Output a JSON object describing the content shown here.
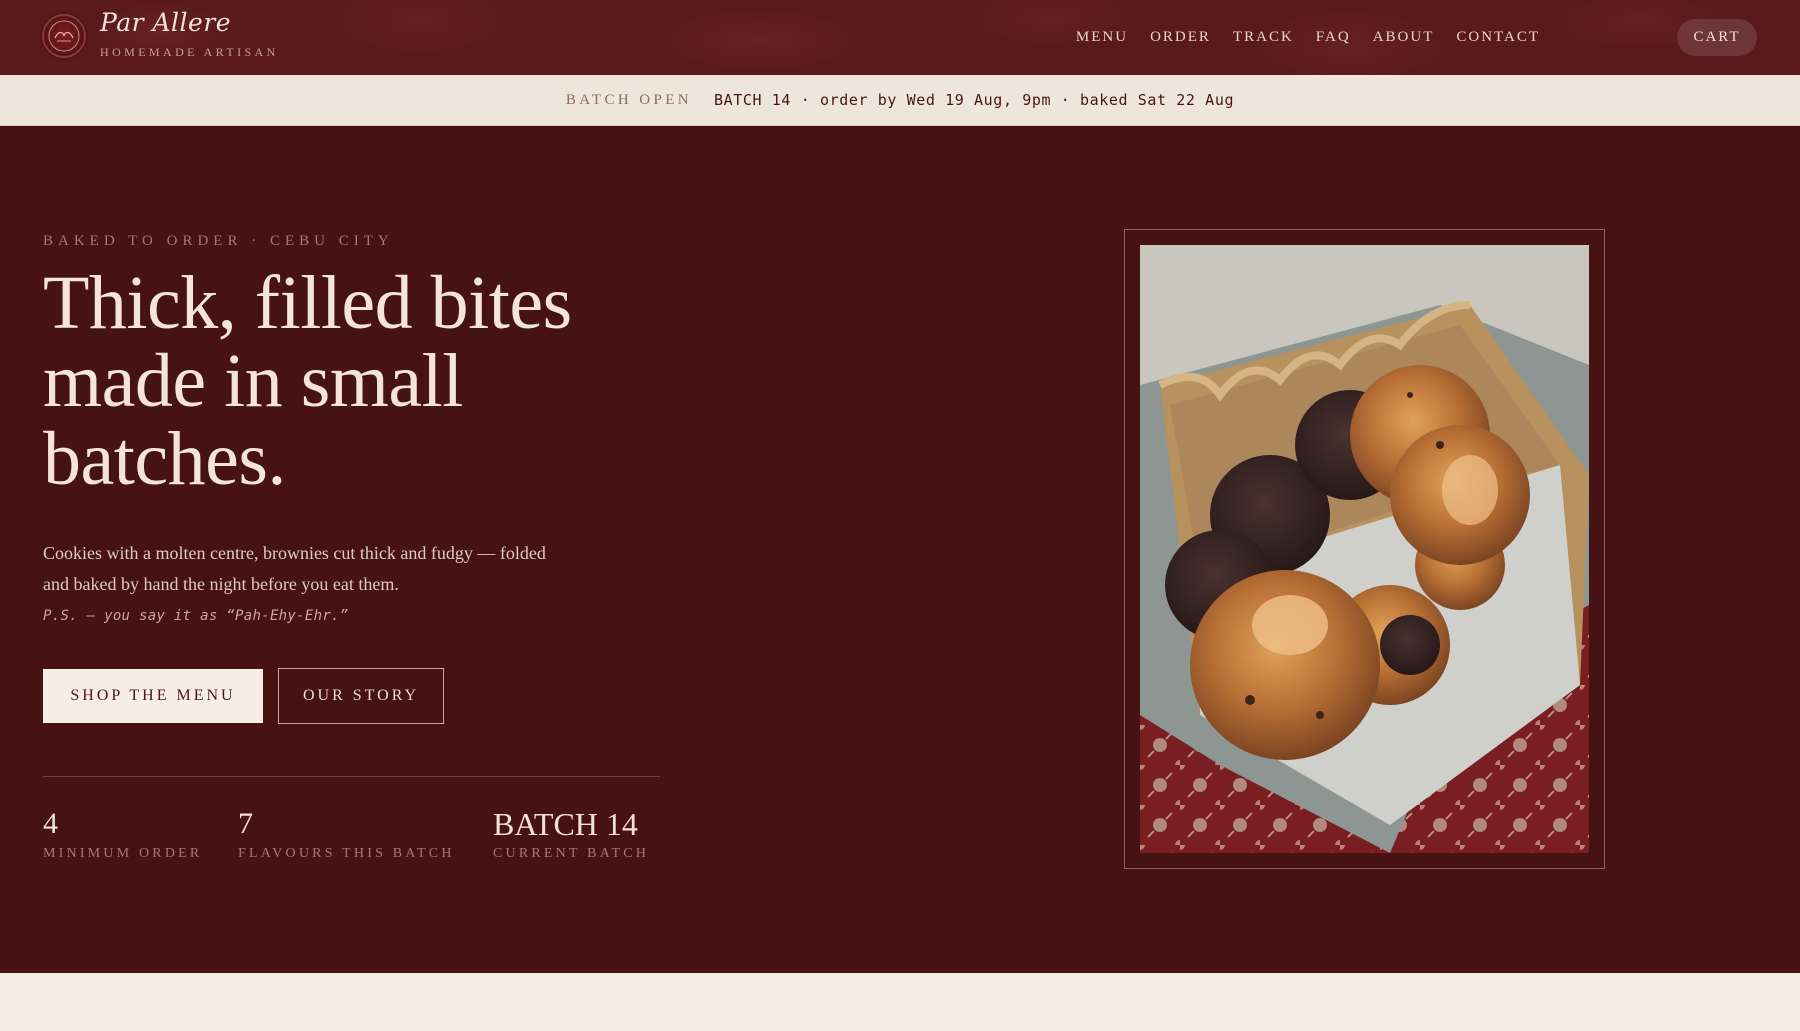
{
  "header": {
    "brand_name": "Par Allere",
    "brand_tagline": "HOMEMADE ARTISAN",
    "nav": [
      "MENU",
      "ORDER",
      "TRACK",
      "FAQ",
      "ABOUT",
      "CONTACT"
    ],
    "cart_label": "CART"
  },
  "announcement": {
    "status": "BATCH OPEN",
    "detail": "BATCH 14 · order by Wed 19 Aug, 9pm · baked Sat 22 Aug"
  },
  "hero": {
    "eyebrow": "BAKED TO ORDER · CEBU CITY",
    "headline": "Thick, filled bites made in small batches.",
    "intro": "Cookies with a molten centre, brownies cut thick and fudgy — folded and baked by hand the night before you eat them.",
    "ps": "P.S. — you say it as “Pah-Ehy-Ehr.”",
    "primary_cta": "SHOP THE MENU",
    "secondary_cta": "OUR STORY",
    "stats": [
      {
        "value": "4",
        "label": "MINIMUM ORDER"
      },
      {
        "value": "7",
        "label": "FLAVOURS THIS BATCH"
      },
      {
        "value": "BATCH 14",
        "label": "CURRENT BATCH"
      }
    ]
  },
  "colors": {
    "header_bg": "#5a1a1c",
    "hero_bg": "#461214",
    "bar_bg": "#eee6dc",
    "cream": "#f6ede6",
    "accent_muted": "#a9796d"
  },
  "icons": {
    "logo": "logo-badge-icon"
  }
}
